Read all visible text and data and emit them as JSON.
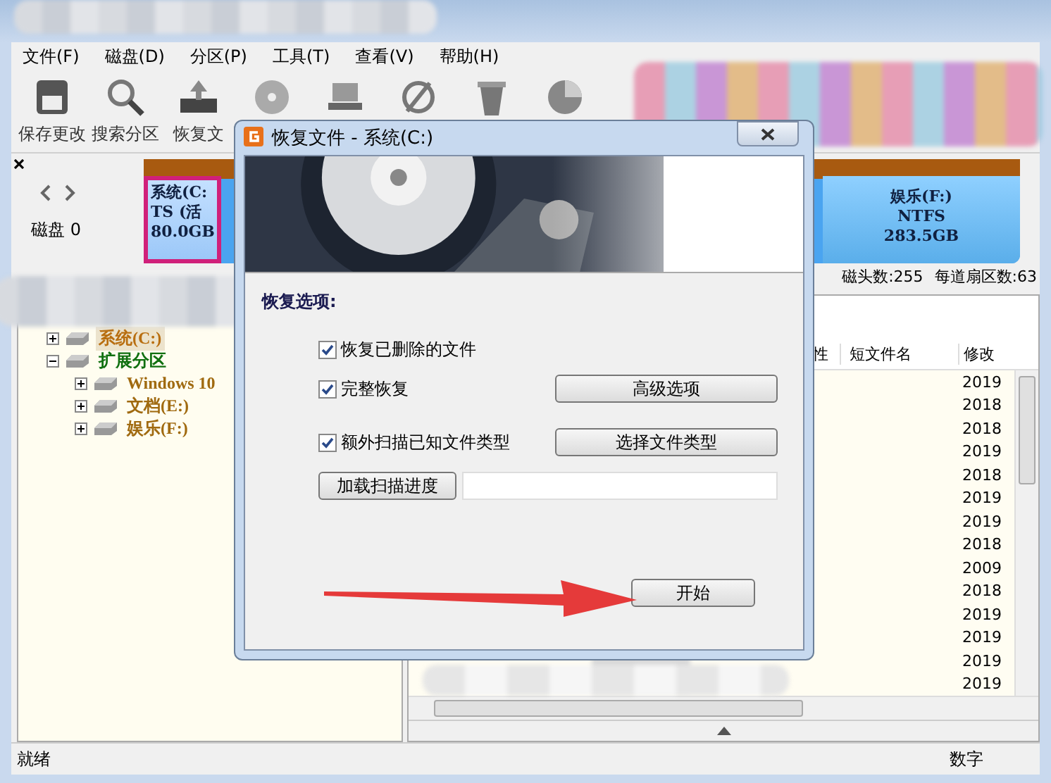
{
  "menu": [
    "文件(F)",
    "磁盘(D)",
    "分区(P)",
    "工具(T)",
    "查看(V)",
    "帮助(H)"
  ],
  "toolbar": [
    {
      "label": "保存更改",
      "kind": "save"
    },
    {
      "label": "搜索分区",
      "kind": "search"
    },
    {
      "label": "恢复文",
      "kind": "restore"
    },
    {
      "kind": "disc"
    },
    {
      "kind": "laptop"
    },
    {
      "kind": "null"
    },
    {
      "kind": "trash"
    },
    {
      "kind": "pie"
    }
  ],
  "disk": {
    "label": "磁盘 0",
    "partitions": [
      {
        "lines": [
          "系统(C:",
          "TS (活",
          "80.0GB"
        ],
        "selected": true
      },
      {
        "lines": [
          "娱乐(F:)",
          "NTFS",
          "283.5GB"
        ],
        "selected": false
      }
    ],
    "info": [
      "磁头数:255",
      "每道扇区数:63"
    ]
  },
  "tree": [
    {
      "label": "系统(C:)",
      "color": "#b86e10",
      "expanded": false,
      "selected": true
    },
    {
      "label": "扩展分区",
      "color": "#107010",
      "expanded": true,
      "selected": false,
      "children": [
        {
          "label": "Windows 10",
          "color": "#a06a10",
          "expanded": false,
          "selected": false
        },
        {
          "label": "文档(E:)",
          "color": "#a06a10",
          "expanded": false,
          "selected": false
        },
        {
          "label": "娱乐(F:)",
          "color": "#a06a10",
          "expanded": false,
          "selected": false
        }
      ]
    }
  ],
  "table": {
    "columns": [
      "性",
      "短文件名",
      "修改"
    ],
    "rows": [
      "2019",
      "2018",
      "2018",
      "2019",
      "2018",
      "2019",
      "2019",
      "2018",
      "2009",
      "2018",
      "2019",
      "2019",
      "2019",
      "2019"
    ]
  },
  "status_bar": [
    "就绪",
    "数字"
  ],
  "dialog": {
    "title": "恢复文件 - 系统(C:)",
    "section": "恢复选项:",
    "options": [
      {
        "label": "恢复已删除的文件",
        "checked": true
      },
      {
        "label": "完整恢复",
        "checked": true,
        "button": "高级选项"
      },
      {
        "label": "额外扫描已知文件类型",
        "checked": true,
        "button": "选择文件类型"
      }
    ],
    "load_button": "加载扫描进度",
    "start_button": "开始"
  }
}
